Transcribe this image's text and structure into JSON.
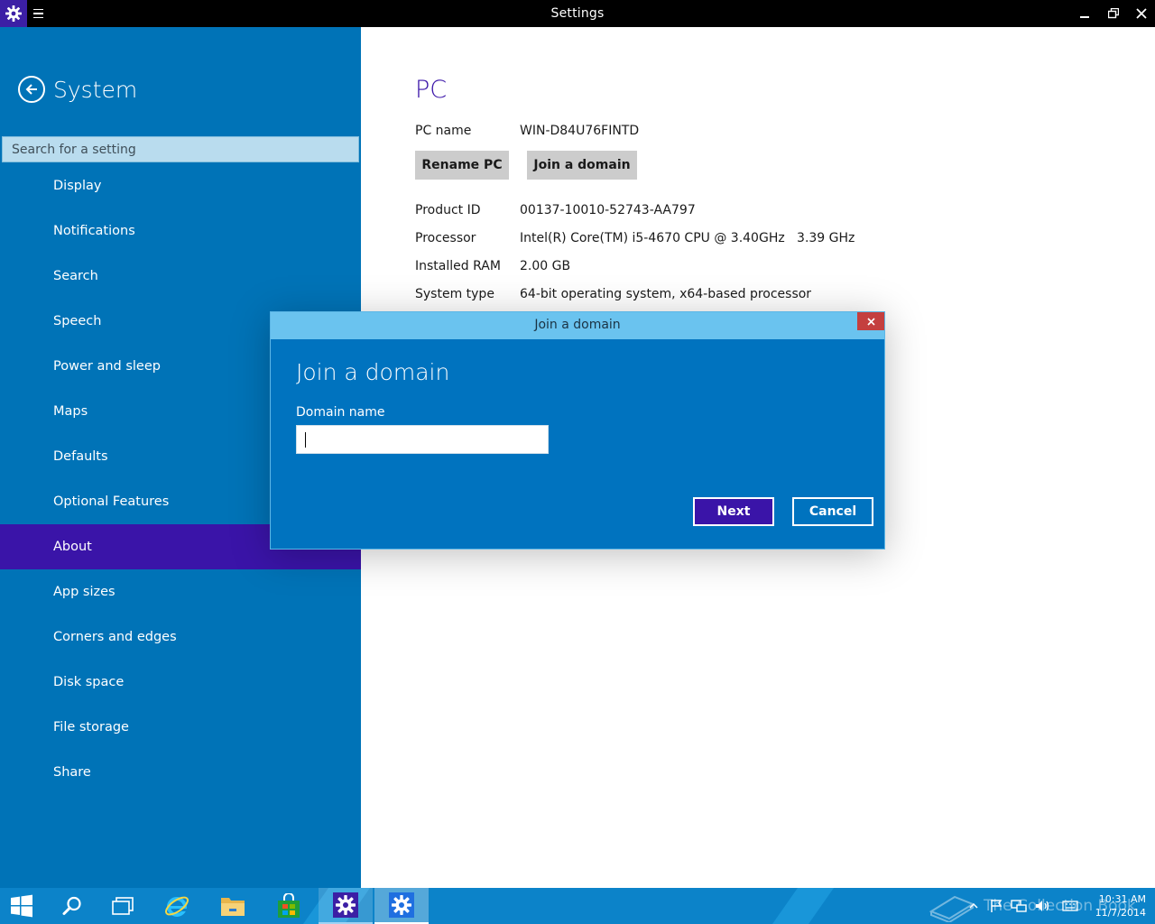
{
  "window": {
    "title": "Settings",
    "icon": "gear-icon",
    "controls": [
      "minimize-icon",
      "maximize-icon",
      "close-icon"
    ]
  },
  "sidebar": {
    "title": "System",
    "search_placeholder": "Search for a setting",
    "items": [
      {
        "label": "Display"
      },
      {
        "label": "Notifications"
      },
      {
        "label": "Search"
      },
      {
        "label": "Speech"
      },
      {
        "label": "Power and sleep"
      },
      {
        "label": "Maps"
      },
      {
        "label": "Defaults"
      },
      {
        "label": "Optional Features"
      },
      {
        "label": "About",
        "selected": true
      },
      {
        "label": "App sizes"
      },
      {
        "label": "Corners and edges"
      },
      {
        "label": "Disk space"
      },
      {
        "label": "File storage"
      },
      {
        "label": "Share"
      }
    ]
  },
  "main": {
    "heading": "PC",
    "pc_name_label": "PC name",
    "pc_name_value": "WIN-D84U76FINTD",
    "rename_button": "Rename PC",
    "join_button": "Join a domain",
    "specs": [
      {
        "label": "Product ID",
        "value": "00137-10010-52743-AA797"
      },
      {
        "label": "Processor",
        "value": "Intel(R) Core(TM) i5-4670 CPU @ 3.40GHz   3.39 GHz"
      },
      {
        "label": "Installed RAM",
        "value": "2.00 GB"
      },
      {
        "label": "System type",
        "value": "64-bit operating system, x64-based processor"
      }
    ]
  },
  "dialog": {
    "title": "Join a domain",
    "heading": "Join a domain",
    "field_label": "Domain name",
    "field_value": "",
    "next_button": "Next",
    "cancel_button": "Cancel"
  },
  "taskbar": {
    "apps": [
      "start-icon",
      "search-icon",
      "task-view-icon",
      "internet-explorer-icon",
      "file-explorer-icon",
      "store-icon",
      "settings-icon",
      "settings-icon"
    ],
    "tray_icons": [
      "show-hidden-icons-icon",
      "action-center-flag-icon",
      "network-icon",
      "volume-icon",
      "keyboard-icon"
    ],
    "time": "10:31 AM",
    "date": "11/7/2014",
    "watermark": "The Collection Book"
  },
  "colors": {
    "sidebar_bg": "#0073b7",
    "accent": "#3a14a8",
    "dialog_bg": "#0073bf",
    "dialog_titlebar": "#6ac3ef",
    "taskbar_bg": "#0c83c9"
  }
}
